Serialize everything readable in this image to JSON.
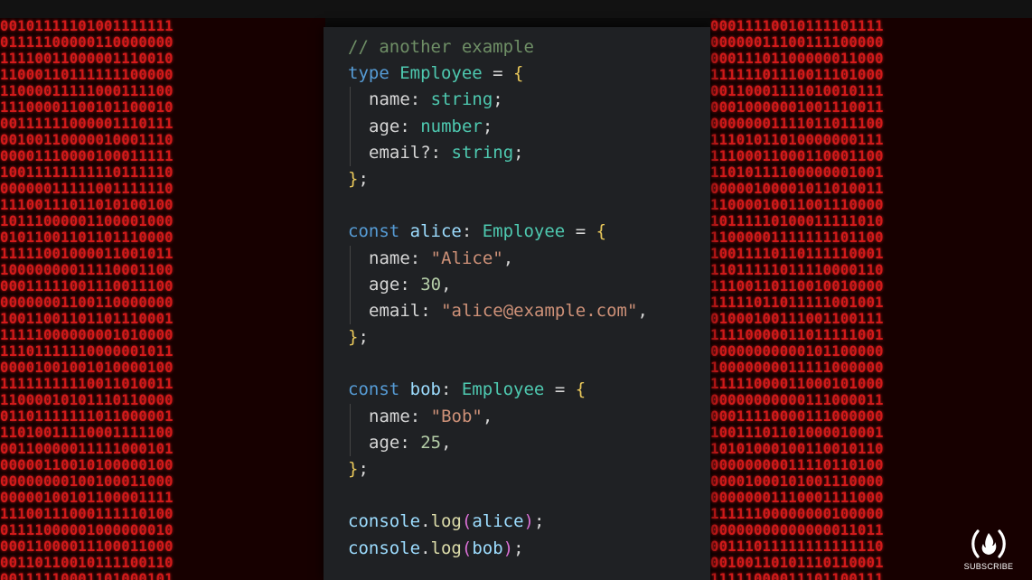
{
  "code_lines": [
    [
      {
        "t": "// another example",
        "c": "comment"
      }
    ],
    [
      {
        "t": "type ",
        "c": "keyword"
      },
      {
        "t": "Employee",
        "c": "type"
      },
      {
        "t": " = ",
        "c": "punct"
      },
      {
        "t": "{",
        "c": "brace"
      }
    ],
    [
      {
        "t": "name",
        "c": "prop"
      },
      {
        "t": ": ",
        "c": "punct"
      },
      {
        "t": "string",
        "c": "prim"
      },
      {
        "t": ";",
        "c": "punct"
      }
    ],
    [
      {
        "t": "age",
        "c": "prop"
      },
      {
        "t": ": ",
        "c": "punct"
      },
      {
        "t": "number",
        "c": "prim"
      },
      {
        "t": ";",
        "c": "punct"
      }
    ],
    [
      {
        "t": "email?",
        "c": "prop"
      },
      {
        "t": ": ",
        "c": "punct"
      },
      {
        "t": "string",
        "c": "prim"
      },
      {
        "t": ";",
        "c": "punct"
      }
    ],
    [
      {
        "t": "}",
        "c": "brace"
      },
      {
        "t": ";",
        "c": "punct"
      }
    ],
    [],
    [
      {
        "t": "const ",
        "c": "keyword"
      },
      {
        "t": "alice",
        "c": "var"
      },
      {
        "t": ": ",
        "c": "punct"
      },
      {
        "t": "Employee",
        "c": "type"
      },
      {
        "t": " = ",
        "c": "punct"
      },
      {
        "t": "{",
        "c": "brace"
      }
    ],
    [
      {
        "t": "name",
        "c": "prop"
      },
      {
        "t": ": ",
        "c": "punct"
      },
      {
        "t": "\"Alice\"",
        "c": "str"
      },
      {
        "t": ",",
        "c": "punct"
      }
    ],
    [
      {
        "t": "age",
        "c": "prop"
      },
      {
        "t": ": ",
        "c": "punct"
      },
      {
        "t": "30",
        "c": "num"
      },
      {
        "t": ",",
        "c": "punct"
      }
    ],
    [
      {
        "t": "email",
        "c": "prop"
      },
      {
        "t": ": ",
        "c": "punct"
      },
      {
        "t": "\"alice@example.com\"",
        "c": "str"
      },
      {
        "t": ",",
        "c": "punct"
      }
    ],
    [
      {
        "t": "}",
        "c": "brace"
      },
      {
        "t": ";",
        "c": "punct"
      }
    ],
    [],
    [
      {
        "t": "const ",
        "c": "keyword"
      },
      {
        "t": "bob",
        "c": "var"
      },
      {
        "t": ": ",
        "c": "punct"
      },
      {
        "t": "Employee",
        "c": "type"
      },
      {
        "t": " = ",
        "c": "punct"
      },
      {
        "t": "{",
        "c": "brace"
      }
    ],
    [
      {
        "t": "name",
        "c": "prop"
      },
      {
        "t": ": ",
        "c": "punct"
      },
      {
        "t": "\"Bob\"",
        "c": "str"
      },
      {
        "t": ",",
        "c": "punct"
      }
    ],
    [
      {
        "t": "age",
        "c": "prop"
      },
      {
        "t": ": ",
        "c": "punct"
      },
      {
        "t": "25",
        "c": "num"
      },
      {
        "t": ",",
        "c": "punct"
      }
    ],
    [
      {
        "t": "}",
        "c": "brace"
      },
      {
        "t": ";",
        "c": "punct"
      }
    ],
    [],
    [
      {
        "t": "console",
        "c": "var"
      },
      {
        "t": ".",
        "c": "punct"
      },
      {
        "t": "log",
        "c": "fn"
      },
      {
        "t": "(",
        "c": "paren"
      },
      {
        "t": "alice",
        "c": "var"
      },
      {
        "t": ")",
        "c": "paren"
      },
      {
        "t": ";",
        "c": "punct"
      }
    ],
    [
      {
        "t": "console",
        "c": "var"
      },
      {
        "t": ".",
        "c": "punct"
      },
      {
        "t": "log",
        "c": "fn"
      },
      {
        "t": "(",
        "c": "paren"
      },
      {
        "t": "bob",
        "c": "var"
      },
      {
        "t": ")",
        "c": "paren"
      },
      {
        "t": ";",
        "c": "punct"
      }
    ]
  ],
  "indented_lines": [
    2,
    3,
    4,
    8,
    9,
    10,
    14,
    15
  ],
  "binary_left": [
    "00101111101001111111",
    "01111100000110000000",
    "11110011000001110010",
    "11000110111111100000",
    "11000011111000111100",
    "11100001100101100010",
    "00111111000001110111",
    "00100110000010001110",
    "00001110000100011111",
    "10011111111110111110",
    "00000011111001111110",
    "11100111011010100100",
    "10111000001100001000",
    "01011001101101110000",
    "11111001000011001011",
    "10000000011110001100",
    "00011111001110011100",
    "00000001100110000000",
    "10011001101101110001",
    "11111000000001010000",
    "11101111110000001011",
    "00001001001010000100",
    "11111111110011010011",
    "11000010101110110000",
    "01101111111011000001",
    "11010011110001111100",
    "00110000011111000101",
    "00000110010100000100",
    "00000000100100011000",
    "00000100101100001111",
    "11100111000111110100",
    "01111000001000000010",
    "00011000011100011000",
    "00110110010111100110",
    "00111110001101000101"
  ],
  "binary_right": [
    "00011110010111101111",
    "00000011100111100000",
    "00011101100000011000",
    "11111101110011101000",
    "00110001111010010111",
    "00010000001001110011",
    "00000001111011011100",
    "11101011010000000111",
    "11100011000110001100",
    "11010111100000001001",
    "00000100001011010011",
    "11000010011001110000",
    "10111110100011111010",
    "11000001111111101100",
    "10011110110111110001",
    "11011111011110000110",
    "11100110110010010000",
    "11111011011111001001",
    "01000100111001100111",
    "11110000011011111001",
    "00000000000101100000",
    "10000000011111000000",
    "11111000011000101000",
    "00000000000111000011",
    "00011110000111000000",
    "10011101101000010001",
    "10101000100110010110",
    "00000000011110110100",
    "00001000101001110000",
    "00000001110001111000",
    "11111100000000100000",
    "00000000000000011011",
    "00111011111111111110",
    "00100110101110110001",
    "11111000011101100111"
  ],
  "subscribe_label": "SUBSCRIBE",
  "colors": {
    "binary_red": "#d21a1a",
    "editor_bg": "#1f2124",
    "keyword": "#569cd6",
    "type": "#4ec9b0",
    "string": "#ce9178",
    "number": "#b5cea8",
    "brace": "#e8c75a"
  },
  "icons": {
    "subscribe_logo": "freecodecamp-flame-icon"
  }
}
